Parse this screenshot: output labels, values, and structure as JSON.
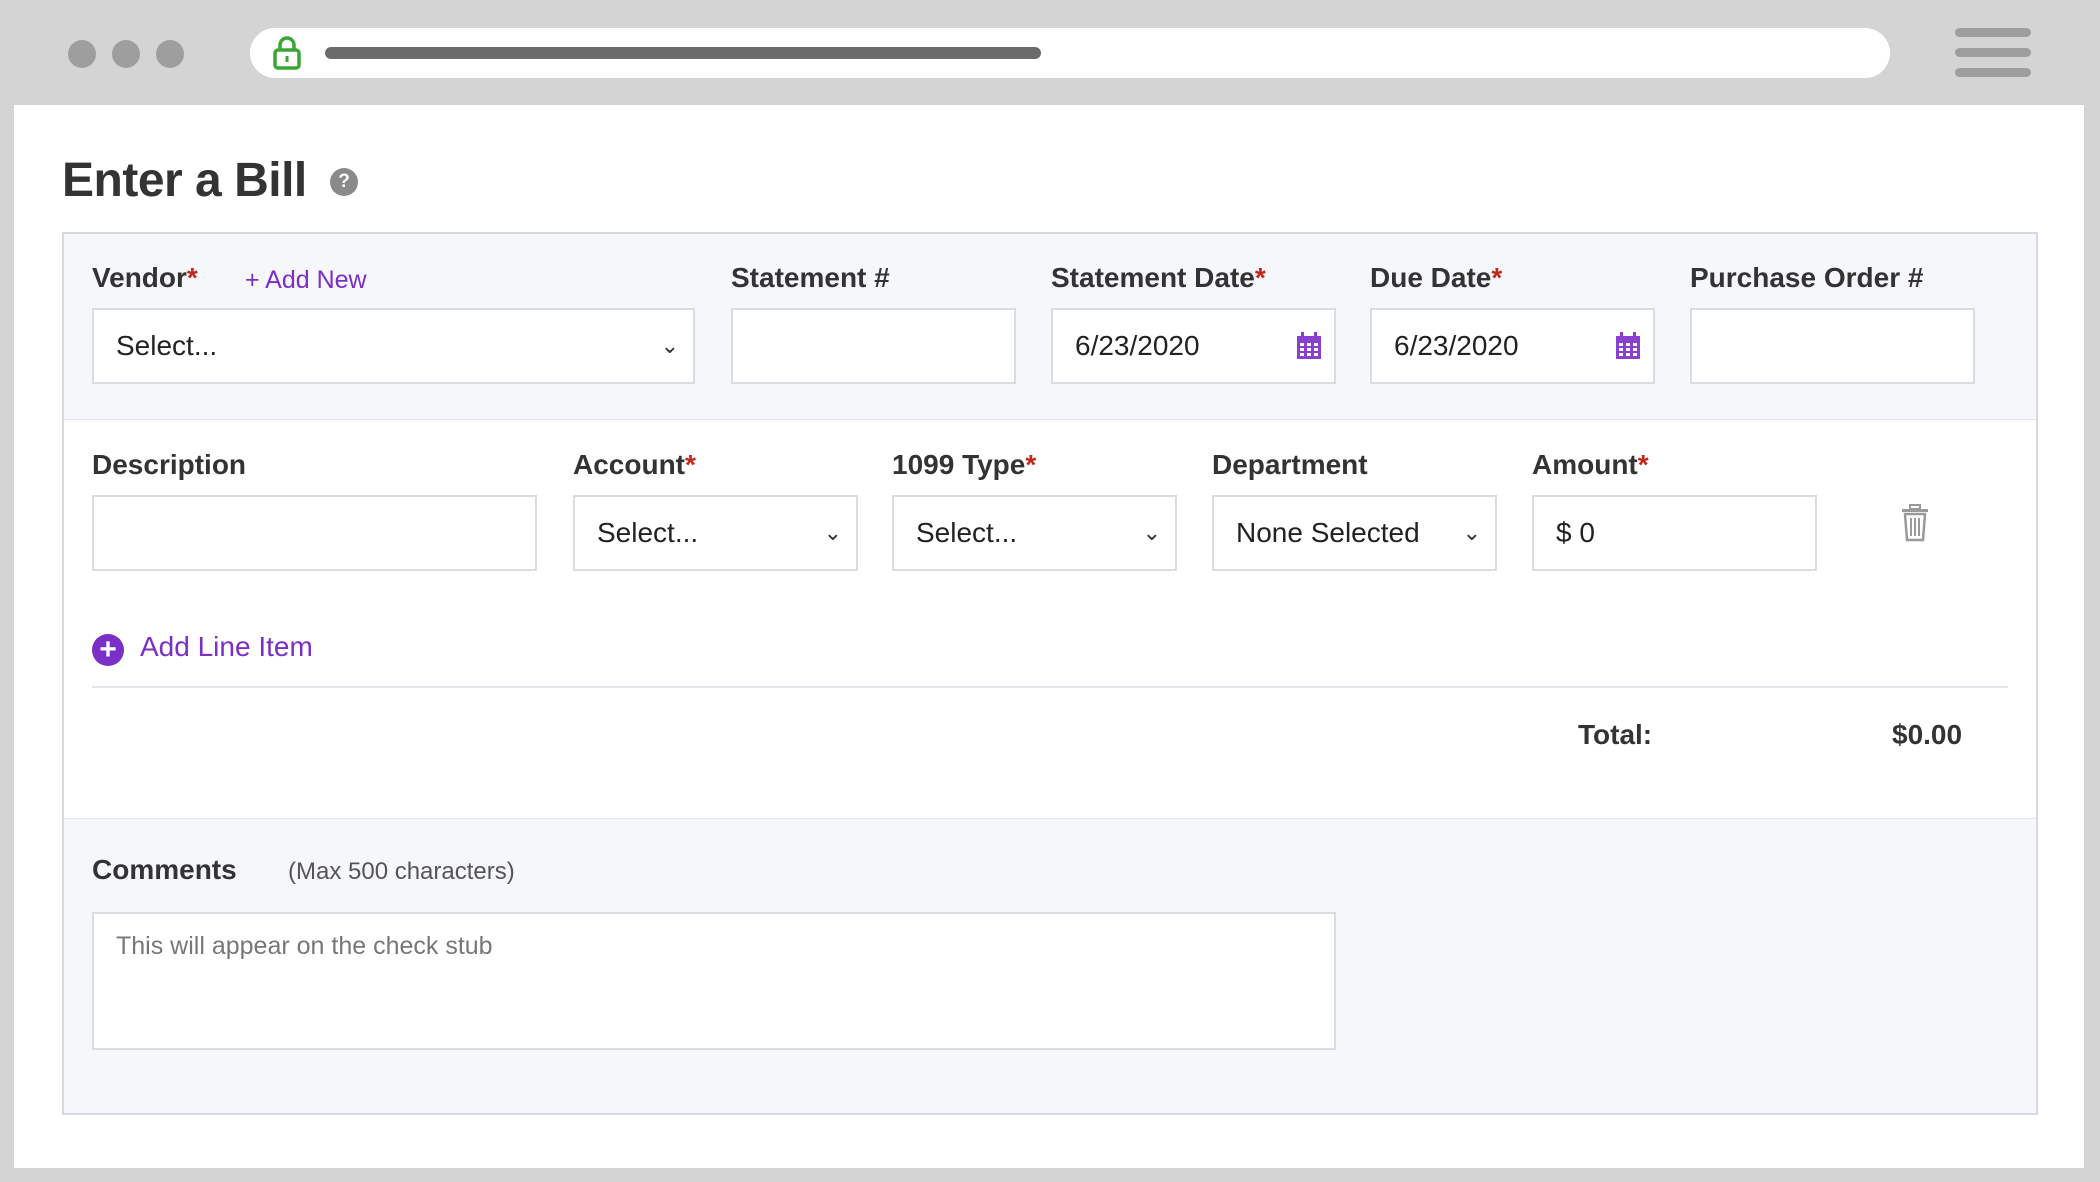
{
  "browser": {
    "icons": {
      "lock": "lock-icon",
      "menu": "hamburger-menu-icon"
    },
    "colors": {
      "lock": "#3aa635"
    }
  },
  "page": {
    "title": "Enter a Bill",
    "help_glyph": "?"
  },
  "header_fields": {
    "vendor": {
      "label": "Vendor",
      "required": "*",
      "add_new": "+ Add New",
      "value": "Select..."
    },
    "statement_number": {
      "label": "Statement #",
      "value": ""
    },
    "statement_date": {
      "label": "Statement Date",
      "required": "*",
      "value": "6/23/2020"
    },
    "due_date": {
      "label": "Due Date",
      "required": "*",
      "value": "6/23/2020"
    },
    "purchase_order": {
      "label": "Purchase Order #",
      "value": ""
    }
  },
  "line_item": {
    "description": {
      "label": "Description",
      "value": ""
    },
    "account": {
      "label": "Account",
      "required": "*",
      "value": "Select..."
    },
    "type_1099": {
      "label": "1099 Type",
      "required": "*",
      "value": "Select..."
    },
    "department": {
      "label": "Department",
      "value": "None Selected"
    },
    "amount": {
      "label": "Amount",
      "required": "*",
      "currency": "$",
      "value": "0"
    }
  },
  "add_line_item": {
    "plus": "+",
    "label": "Add Line Item"
  },
  "totals": {
    "label": "Total:",
    "value": "$0.00"
  },
  "comments": {
    "label": "Comments",
    "note": "(Max 500 characters)",
    "placeholder": "This will appear on the check stub"
  },
  "colors": {
    "accent": "#7a2fc7",
    "required": "#c0281c",
    "calendar": "#8a3fd0"
  }
}
